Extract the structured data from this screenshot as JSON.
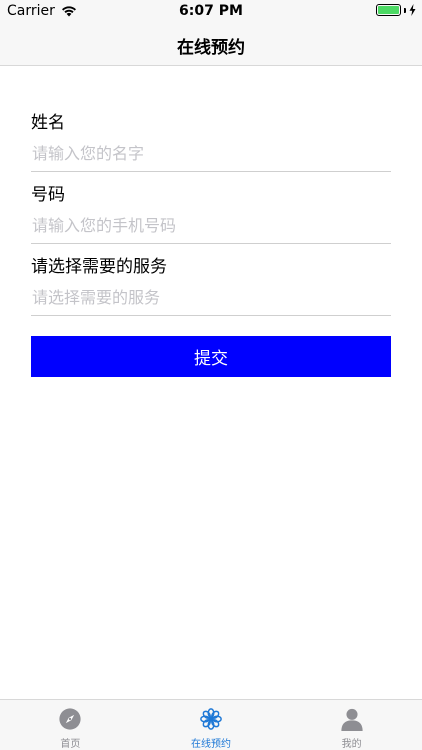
{
  "status_bar": {
    "carrier": "Carrier",
    "time": "6:07 PM",
    "battery_level": 1.0
  },
  "nav": {
    "title": "在线预约"
  },
  "form": {
    "name_label": "姓名",
    "name_placeholder": "请输入您的名字",
    "phone_label": "号码",
    "phone_placeholder": "请输入您的手机号码",
    "service_label": "请选择需要的服务",
    "service_placeholder": "请选择需要的服务",
    "submit_label": "提交"
  },
  "tab_bar": {
    "items": [
      {
        "label": "首页",
        "icon": "compass-icon",
        "active": false
      },
      {
        "label": "在线预约",
        "icon": "flower-icon",
        "active": true
      },
      {
        "label": "我的",
        "icon": "person-icon",
        "active": false
      }
    ]
  },
  "colors": {
    "submit_bg": "#0000ff",
    "tab_active": "#1e78d6",
    "tab_inactive": "#8e8e93",
    "battery": "#4cd964"
  }
}
